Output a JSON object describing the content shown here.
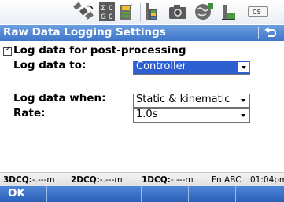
{
  "window": {
    "title": "Raw Data Logging Settings"
  },
  "status_icons": [
    "satellite-icon",
    "sv-count-icon",
    "battery-icon",
    "radio-icon",
    "camera-icon",
    "internet-icon",
    "usb-icon",
    "controller-icon"
  ],
  "form": {
    "log_checkbox": {
      "label": "Log data for post-processing",
      "checked": true
    },
    "log_to": {
      "label": "Log data to:",
      "value": "Controller"
    },
    "log_when": {
      "label": "Log data when:",
      "value": "Static & kinematic"
    },
    "rate": {
      "label": "Rate:",
      "value": "1.0s"
    }
  },
  "bottom_status": {
    "dcq3_label": "3DCQ:",
    "dcq3_value": "-.---m",
    "dcq2_label": "2DCQ:",
    "dcq2_value": "-.---m",
    "dcq1_label": "1DCQ:",
    "dcq1_value": "-.---m",
    "mode": "Fn  ABC",
    "time": "01:04pm"
  },
  "softkeys": {
    "ok_label": "OK"
  },
  "colors": {
    "title_bar": "#3f76c8",
    "selected_field": "#2d5fd1",
    "softkey_bar": "#2a5fb6"
  }
}
